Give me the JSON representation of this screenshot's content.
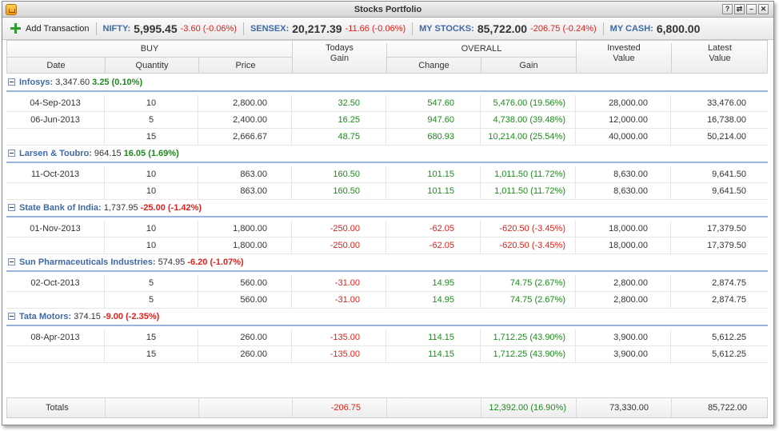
{
  "window": {
    "title": "Stocks Portfolio",
    "controls": [
      "?",
      "⇄",
      "–",
      "✕"
    ]
  },
  "toolbar": {
    "add_label": "Add Transaction",
    "nifty": {
      "label": "NIFTY:",
      "value": "5,995.45",
      "change": "-3.60 (-0.06%)"
    },
    "sensex": {
      "label": "SENSEX:",
      "value": "20,217.39",
      "change": "-11.66 (-0.06%)"
    },
    "mystocks": {
      "label": "MY STOCKS:",
      "value": "85,722.00",
      "change": "-206.75 (-0.24%)"
    },
    "mycash": {
      "label": "MY CASH:",
      "value": "6,800.00"
    }
  },
  "header": {
    "buy": "BUY",
    "date": "Date",
    "quantity": "Quantity",
    "price": "Price",
    "todays_gain": "Todays Gain",
    "overall": "OVERALL",
    "change": "Change",
    "gain": "Gain",
    "invested": "Invested Value",
    "latest": "Latest Value"
  },
  "groups": [
    {
      "name": "Infosys:",
      "price": "3,347.60",
      "change": "3.25 (0.10%)",
      "trend": "up",
      "rows": [
        {
          "date": "04-Sep-2013",
          "qty": "10",
          "price": "2,800.00",
          "today": "32.50",
          "change": "547.60",
          "gain": "5,476.00 (19.56%)",
          "invested": "28,000.00",
          "latest": "33,476.00"
        },
        {
          "date": "06-Jun-2013",
          "qty": "5",
          "price": "2,400.00",
          "today": "16.25",
          "change": "947.60",
          "gain": "4,738.00 (39.48%)",
          "invested": "12,000.00",
          "latest": "16,738.00"
        }
      ],
      "summary": {
        "qty": "15",
        "price": "2,666.67",
        "today": "48.75",
        "change": "680.93",
        "gain": "10,214.00 (25.54%)",
        "invested": "40,000.00",
        "latest": "50,214.00"
      },
      "today_trend": "up",
      "overall_trend": "up"
    },
    {
      "name": "Larsen & Toubro:",
      "price": "964.15",
      "change": "16.05 (1.69%)",
      "trend": "up",
      "rows": [
        {
          "date": "11-Oct-2013",
          "qty": "10",
          "price": "863.00",
          "today": "160.50",
          "change": "101.15",
          "gain": "1,011.50 (11.72%)",
          "invested": "8,630.00",
          "latest": "9,641.50"
        }
      ],
      "summary": {
        "qty": "10",
        "price": "863.00",
        "today": "160.50",
        "change": "101.15",
        "gain": "1,011.50 (11.72%)",
        "invested": "8,630.00",
        "latest": "9,641.50"
      },
      "today_trend": "up",
      "overall_trend": "up"
    },
    {
      "name": "State Bank of India:",
      "price": "1,737.95",
      "change": "-25.00 (-1.42%)",
      "trend": "down",
      "rows": [
        {
          "date": "01-Nov-2013",
          "qty": "10",
          "price": "1,800.00",
          "today": "-250.00",
          "change": "-62.05",
          "gain": "-620.50 (-3.45%)",
          "invested": "18,000.00",
          "latest": "17,379.50"
        }
      ],
      "summary": {
        "qty": "10",
        "price": "1,800.00",
        "today": "-250.00",
        "change": "-62.05",
        "gain": "-620.50 (-3.45%)",
        "invested": "18,000.00",
        "latest": "17,379.50"
      },
      "today_trend": "down",
      "overall_trend": "down"
    },
    {
      "name": "Sun Pharmaceuticals Industries:",
      "price": "574.95",
      "change": "-6.20 (-1.07%)",
      "trend": "down",
      "rows": [
        {
          "date": "02-Oct-2013",
          "qty": "5",
          "price": "560.00",
          "today": "-31.00",
          "change": "14.95",
          "gain": "74.75 (2.67%)",
          "invested": "2,800.00",
          "latest": "2,874.75"
        }
      ],
      "summary": {
        "qty": "5",
        "price": "560.00",
        "today": "-31.00",
        "change": "14.95",
        "gain": "74.75 (2.67%)",
        "invested": "2,800.00",
        "latest": "2,874.75"
      },
      "today_trend": "down",
      "overall_trend": "up"
    },
    {
      "name": "Tata Motors:",
      "price": "374.15",
      "change": "-9.00 (-2.35%)",
      "trend": "down",
      "rows": [
        {
          "date": "08-Apr-2013",
          "qty": "15",
          "price": "260.00",
          "today": "-135.00",
          "change": "114.15",
          "gain": "1,712.25 (43.90%)",
          "invested": "3,900.00",
          "latest": "5,612.25"
        }
      ],
      "summary": {
        "qty": "15",
        "price": "260.00",
        "today": "-135.00",
        "change": "114.15",
        "gain": "1,712.25 (43.90%)",
        "invested": "3,900.00",
        "latest": "5,612.25"
      },
      "today_trend": "down",
      "overall_trend": "up"
    }
  ],
  "totals": {
    "label": "Totals",
    "today": "-206.75",
    "gain": "12,392.00 (16.90%)",
    "invested": "73,330.00",
    "latest": "85,722.00"
  },
  "colors": {
    "up": "#1c8a1c",
    "down": "#e0201a",
    "accent": "#3e6aa6"
  }
}
